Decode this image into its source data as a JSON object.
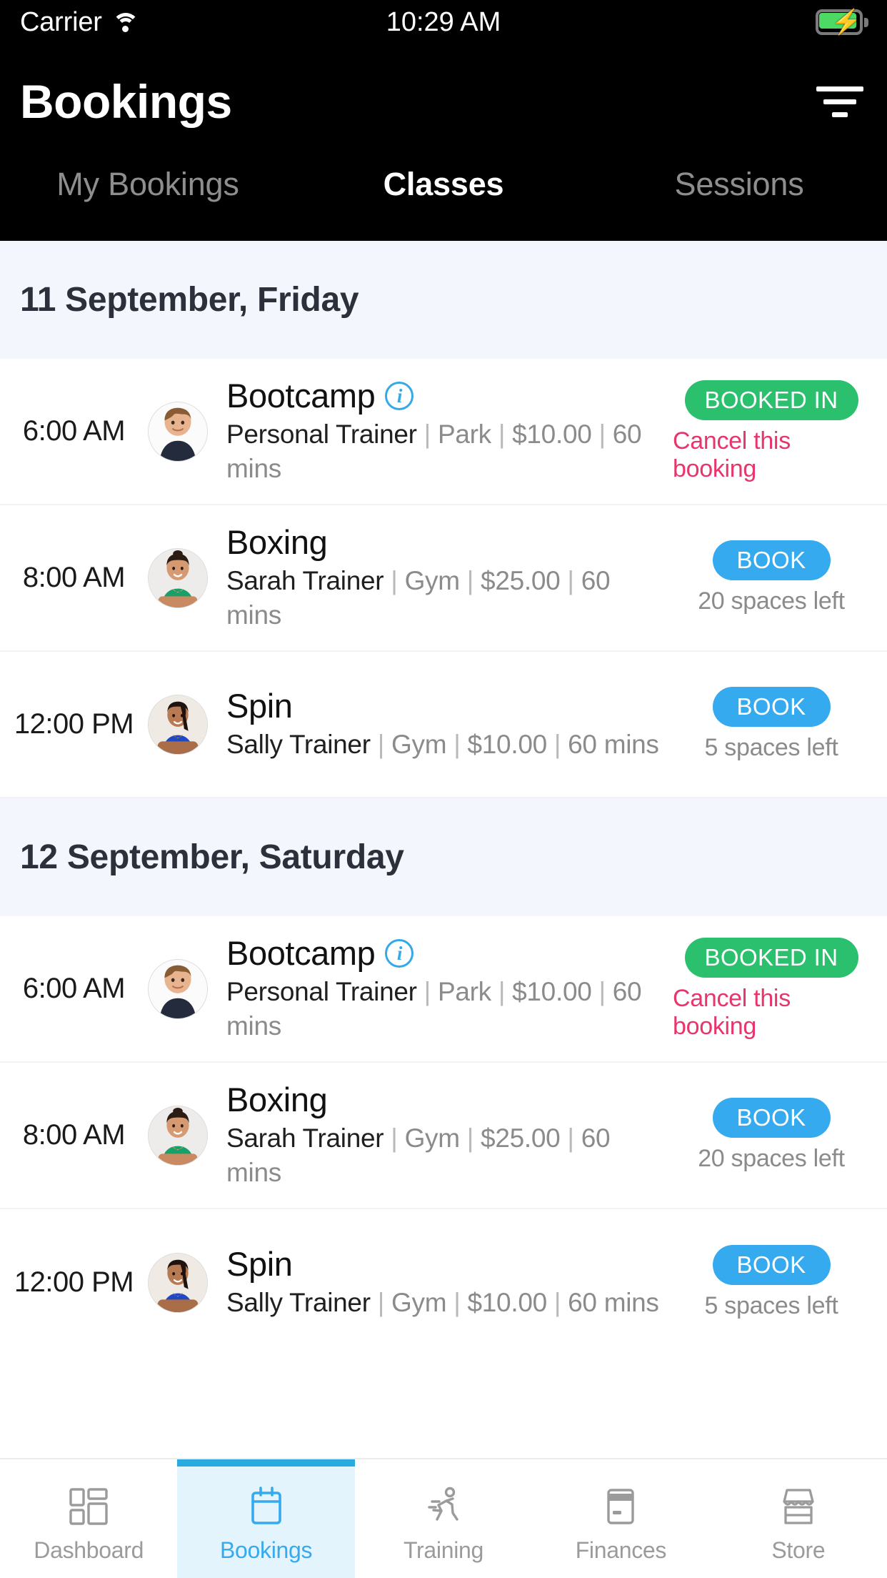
{
  "status_bar": {
    "carrier": "Carrier",
    "wifi_icon": "wifi-icon",
    "time": "10:29 AM",
    "battery_icon": "battery-charging-icon",
    "battery_color": "#4cd964"
  },
  "header": {
    "title": "Bookings",
    "filter_icon": "filter-icon"
  },
  "tabs": [
    {
      "label": "My Bookings",
      "active": false
    },
    {
      "label": "Classes",
      "active": true
    },
    {
      "label": "Sessions",
      "active": false
    }
  ],
  "colors": {
    "booked_green": "#2ac06d",
    "book_blue": "#35aaee",
    "cancel_pink": "#e8356b",
    "info_blue": "#35a9e8",
    "day_header_bg": "#f4f6fd",
    "active_nav_bg": "#e4f4fd",
    "active_nav_bar": "#29aae1"
  },
  "days": [
    {
      "date_label": "11 September, Friday",
      "rows": [
        {
          "time": "6:00 AM",
          "avatar": "avatar-male-bootcamp-trainer",
          "class_name": "Bootcamp",
          "has_info_icon": true,
          "info_icon": "info-icon",
          "trainer": "Personal Trainer",
          "location": "Park",
          "price": "$10.00",
          "duration": "60 mins",
          "details": "Personal Trainer | Park | $10.00 | 60 mins",
          "action_label": "BOOKED IN",
          "action_state": "booked",
          "note": "Cancel this booking",
          "note_type": "cancel"
        },
        {
          "time": "8:00 AM",
          "avatar": "avatar-female-boxing-trainer",
          "class_name": "Boxing",
          "has_info_icon": false,
          "trainer": "Sarah Trainer",
          "location": "Gym",
          "price": "$25.00",
          "duration": "60 mins",
          "details": "Sarah Trainer | Gym | $25.00 | 60 mins",
          "action_label": "BOOK",
          "action_state": "available",
          "note": "20 spaces left",
          "note_type": "spaces"
        },
        {
          "time": "12:00 PM",
          "avatar": "avatar-female-spin-trainer",
          "class_name": "Spin",
          "has_info_icon": false,
          "trainer": "Sally Trainer",
          "location": "Gym",
          "price": "$10.00",
          "duration": "60 mins",
          "details": "Sally Trainer | Gym | $10.00 | 60 mins",
          "action_label": "BOOK",
          "action_state": "available",
          "note": "5 spaces left",
          "note_type": "spaces"
        }
      ]
    },
    {
      "date_label": "12 September, Saturday",
      "rows": [
        {
          "time": "6:00 AM",
          "avatar": "avatar-male-bootcamp-trainer",
          "class_name": "Bootcamp",
          "has_info_icon": true,
          "info_icon": "info-icon",
          "trainer": "Personal Trainer",
          "location": "Park",
          "price": "$10.00",
          "duration": "60 mins",
          "details": "Personal Trainer | Park | $10.00 | 60 mins",
          "action_label": "BOOKED IN",
          "action_state": "booked",
          "note": "Cancel this booking",
          "note_type": "cancel"
        },
        {
          "time": "8:00 AM",
          "avatar": "avatar-female-boxing-trainer",
          "class_name": "Boxing",
          "has_info_icon": false,
          "trainer": "Sarah Trainer",
          "location": "Gym",
          "price": "$25.00",
          "duration": "60 mins",
          "details": "Sarah Trainer | Gym | $25.00 | 60 mins",
          "action_label": "BOOK",
          "action_state": "available",
          "note": "20 spaces left",
          "note_type": "spaces"
        },
        {
          "time": "12:00 PM",
          "avatar": "avatar-female-spin-trainer",
          "class_name": "Spin",
          "has_info_icon": false,
          "trainer": "Sally Trainer",
          "location": "Gym",
          "price": "$10.00",
          "duration": "60 mins",
          "details": "Sally Trainer | Gym | $10.00 | 60 mins",
          "action_label": "BOOK",
          "action_state": "available",
          "note": "5 spaces left",
          "note_type": "spaces"
        }
      ]
    }
  ],
  "bottom_nav": [
    {
      "label": "Dashboard",
      "icon": "dashboard-grid-icon",
      "active": false
    },
    {
      "label": "Bookings",
      "icon": "calendar-icon",
      "active": true
    },
    {
      "label": "Training",
      "icon": "running-person-icon",
      "active": false
    },
    {
      "label": "Finances",
      "icon": "credit-card-icon",
      "active": false
    },
    {
      "label": "Store",
      "icon": "shop-awning-icon",
      "active": false
    }
  ]
}
